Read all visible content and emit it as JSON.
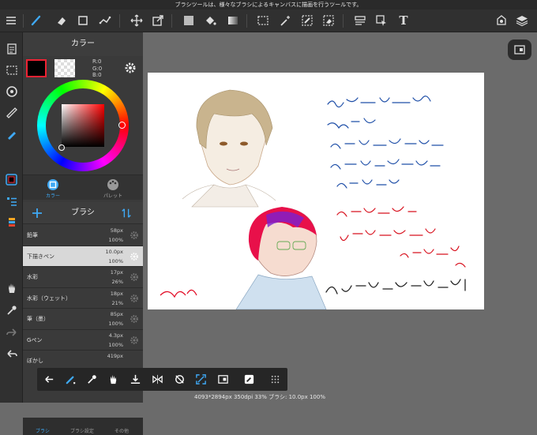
{
  "status_bar": {
    "message": "ブラシツールは、様々なブラシによるキャンバスに描画を行うツールです。"
  },
  "toolbar": {
    "items": [
      "menu-icon",
      "brush-icon",
      "eraser-icon",
      "rect-shape-icon",
      "select-points-icon",
      "move-icon",
      "transform-icon",
      "fill-color-icon",
      "bucket-icon",
      "gradient-icon",
      "selection-rect-icon",
      "magic-wand-icon",
      "select-pen-icon",
      "select-eraser-icon",
      "layout-icon",
      "select-arrow-icon",
      "text-icon",
      "undo-panel-icon",
      "layers-icon"
    ],
    "text_tool_label": "T"
  },
  "color_panel": {
    "title": "カラー",
    "rgb": {
      "r": "R:0",
      "g": "G:0",
      "b": "B:0"
    },
    "main_color": "#000000",
    "sub_color": "transparent",
    "hue_color": "#ff0000",
    "tabs": [
      {
        "label": "カラー",
        "active": true
      },
      {
        "label": "パレット",
        "active": false
      }
    ]
  },
  "brush_panel": {
    "title": "ブラシ",
    "items": [
      {
        "name": "鉛筆",
        "size": "58px",
        "opacity": "100%",
        "selected": false
      },
      {
        "name": "下描きペン",
        "size": "10.0px",
        "opacity": "100%",
        "selected": true
      },
      {
        "name": "水彩",
        "size": "17px",
        "opacity": "26%",
        "selected": false
      },
      {
        "name": "水彩（ウェット）",
        "size": "18px",
        "opacity": "21%",
        "selected": false
      },
      {
        "name": "筆（墨）",
        "size": "85px",
        "opacity": "100%",
        "selected": false
      },
      {
        "name": "Gペン",
        "size": "4.3px",
        "opacity": "100%",
        "selected": false
      },
      {
        "name": "ぼかし",
        "size": "419px",
        "opacity": "",
        "selected": false
      }
    ]
  },
  "bottom_panel_tabs": [
    {
      "label": "ブラシ",
      "active": true
    },
    {
      "label": "ブラシ設定",
      "active": false
    },
    {
      "label": "その他",
      "active": false
    }
  ],
  "canvas_info": "4093*2894px 350dpi 33% ブラシ: 10.0px 100%",
  "accent_color": "#3fa9f5"
}
